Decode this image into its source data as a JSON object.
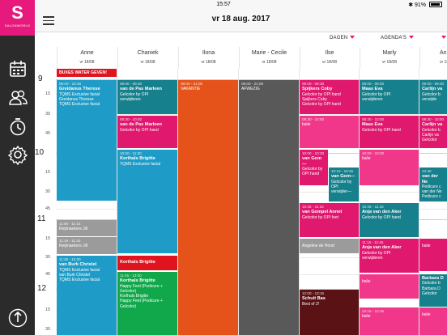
{
  "status": {
    "carrier": "iPad",
    "time": "15:57",
    "battery": "91%",
    "battery_level": 0.91
  },
  "brand": {
    "letter": "S",
    "name": "SALONWORLD",
    "color": "#e8197d"
  },
  "header": {
    "date": "vr 18 aug. 2017"
  },
  "filters": {
    "days": "DAGEN",
    "agendas": "AGENDA'S"
  },
  "columns": [
    {
      "name": "Anne",
      "date": "vr 18/08"
    },
    {
      "name": "Chaniek",
      "date": "vr 18/08"
    },
    {
      "name": "Ilona",
      "date": "vr 18/08"
    },
    {
      "name": "Marie - Cecile",
      "date": "vr 18/08"
    },
    {
      "name": "Ilse",
      "date": "vr 18/08"
    },
    {
      "name": "Marly",
      "date": "vr 18/08"
    },
    {
      "name": "Ann",
      "date": "vr 18/08"
    }
  ],
  "hours": [
    {
      "h": "9",
      "marks": [
        "15",
        "30",
        "45"
      ]
    },
    {
      "h": "10",
      "marks": [
        "15",
        "30",
        "45"
      ]
    },
    {
      "h": "11",
      "marks": [
        "15",
        "30",
        "45"
      ]
    },
    {
      "h": "12",
      "marks": [
        "15",
        "30"
      ]
    }
  ],
  "appointments": {
    "anne": [
      {
        "banner": "BUXES WATER GEVEN!"
      },
      {
        "time": "09:00 - 10:45",
        "lines": [
          "Greidanus Therese",
          "TQMS Exclusive facial",
          "Greidanus Therese",
          "TQMS Exclusive facial"
        ]
      },
      {
        "time": "11:00 - 11:15",
        "lines": [
          "Reijmaekers Jill"
        ]
      },
      {
        "time": "11:15 - 11:30",
        "lines": [
          "Reijmaekers Jill"
        ]
      },
      {
        "time": "11:30 - 12:30",
        "lines": [
          "van Burk Christel",
          "TQMS Exclusive facial",
          "van Burk Christel",
          "TQMS Exclusive facial"
        ]
      }
    ],
    "chaniek": [
      {
        "time": "09:00 - 09:30",
        "lines": [
          "van de Pas Marleen",
          "Gelcolor by OPI",
          "verwijderen"
        ]
      },
      {
        "time": "09:30 - 10:00",
        "lines": [
          "van de Pas Marleen",
          "Gelcolor by OPI hand"
        ]
      },
      {
        "time": "10:00 - 11:30",
        "lines": [
          "Korthals Brigitte",
          "TQMS Exclusive facial"
        ]
      },
      {
        "time": "",
        "lines": [
          "Korthals Brigitte"
        ]
      },
      {
        "time": "11:45 - 13:00",
        "lines": [
          "Korthals Brigitte",
          "Happy Feet (Pedicure +",
          "Gelcolor)",
          "Korthals Brigitte",
          "Happy Feet (Pedicure +",
          "Gelcolor)"
        ]
      }
    ],
    "ilona": [
      {
        "time": "09:00 - 21:00",
        "lines": [
          "VAKANTIE"
        ]
      }
    ],
    "marie": [
      {
        "time": "09:00 - 21:00",
        "lines": [
          "AFWEZIG"
        ]
      }
    ],
    "ilse": [
      {
        "time": "09:00 - 09:30",
        "lines": [
          "Spijkers Coby",
          "Gelcolor by OPI hand",
          "Spijkers Coby",
          "Gelcolor by OPI hand"
        ]
      },
      {
        "time": "09:30 - 10:00",
        "lines": [
          "balie"
        ]
      },
      {
        "time": "10:00 - 10:30",
        "lines": [
          "van Gom—",
          "Gelcolor by",
          "OPI hand"
        ]
      },
      {
        "time": "10:15 - 10:45",
        "lines": [
          "van Gom—",
          "Gelcolor by",
          "OPI",
          "verwijder—"
        ]
      },
      {
        "time": "10:45 - 11:15",
        "lines": [
          "van Gompel Annet",
          "Gelcolor by OPI feet"
        ]
      },
      {
        "time": "",
        "lines": [
          "Angeline de Hond"
        ]
      },
      {
        "time": "12:00 - 13:15",
        "lines": [
          "Schuit Bas",
          "Best of 2!"
        ]
      }
    ],
    "marly": [
      {
        "time": "09:00 - 09:30",
        "lines": [
          "Maas Eva",
          "Gelcolor by OPI",
          "verwijderen"
        ]
      },
      {
        "time": "09:30 - 10:00",
        "lines": [
          "Maas Eva",
          "Gelcolor by OPI hand"
        ]
      },
      {
        "time": "10:00 - 10:30",
        "lines": [
          "balie"
        ]
      },
      {
        "time": "10:45 - 11:15",
        "lines": [
          "Anja van den Aker",
          "Gelcolor by OPI hand"
        ]
      },
      {
        "time": "11:15 - 11:45",
        "lines": [
          "Anja van den Aker",
          "Gelcolor by OPI",
          "verwijderen"
        ]
      },
      {
        "time": "",
        "lines": [
          "balie"
        ]
      },
      {
        "time": "12:15 - 12:45",
        "lines": [
          "balie"
        ]
      }
    ],
    "ann": [
      {
        "time": "09:00 - 09:30",
        "lines": [
          "Carlijn va",
          "Gelcolor b",
          "verwijde"
        ]
      },
      {
        "time": "09:30 - 10:00",
        "lines": [
          "Carlijn va",
          "Gelcolor b",
          "Carlijn va",
          "Gelcolor"
        ]
      },
      {
        "time": "10:30",
        "lines": [
          "van der Ne",
          "Pedicure c",
          "van der Ne",
          "Pedicure c"
        ]
      },
      {
        "time": "",
        "lines": [
          "balie"
        ]
      },
      {
        "time": "",
        "lines": [
          "Barbara D",
          "Gelcolor b",
          "Barbara D",
          "Gelcolor"
        ]
      },
      {
        "time": "",
        "lines": [
          "balie"
        ]
      }
    ]
  },
  "sidebar": {
    "icons": [
      "calendar-icon",
      "customers-icon",
      "timer-icon",
      "settings-icon",
      "logout-icon"
    ]
  }
}
